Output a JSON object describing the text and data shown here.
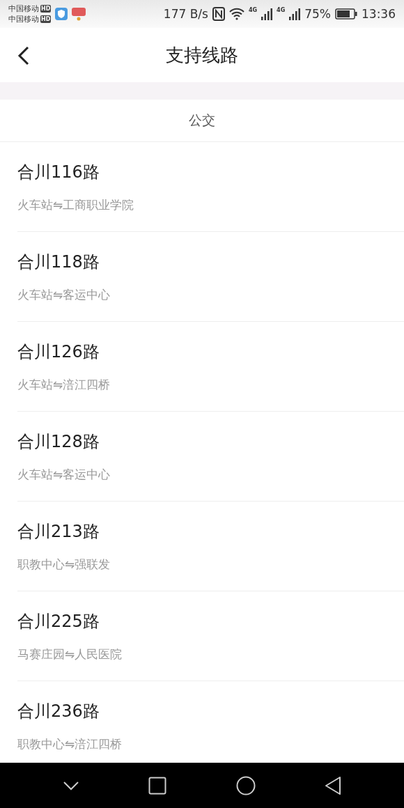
{
  "status_bar": {
    "carriers": [
      {
        "name": "中国移动",
        "badge": "HD"
      },
      {
        "name": "中国移动",
        "badge": "HD"
      }
    ],
    "speed": "177 B/s",
    "network_1": "4G",
    "network_2": "4G",
    "battery": "75%",
    "time": "13:36"
  },
  "header": {
    "title": "支持线路"
  },
  "section": {
    "title": "公交"
  },
  "routes": [
    {
      "name": "合川116路",
      "stops": "火车站⇋工商职业学院"
    },
    {
      "name": "合川118路",
      "stops": "火车站⇋客运中心"
    },
    {
      "name": "合川126路",
      "stops": "火车站⇋涪江四桥"
    },
    {
      "name": "合川128路",
      "stops": "火车站⇋客运中心"
    },
    {
      "name": "合川213路",
      "stops": "职教中心⇋强联发"
    },
    {
      "name": "合川225路",
      "stops": "马赛庄园⇋人民医院"
    },
    {
      "name": "合川236路",
      "stops": "职教中心⇋涪江四桥"
    }
  ]
}
